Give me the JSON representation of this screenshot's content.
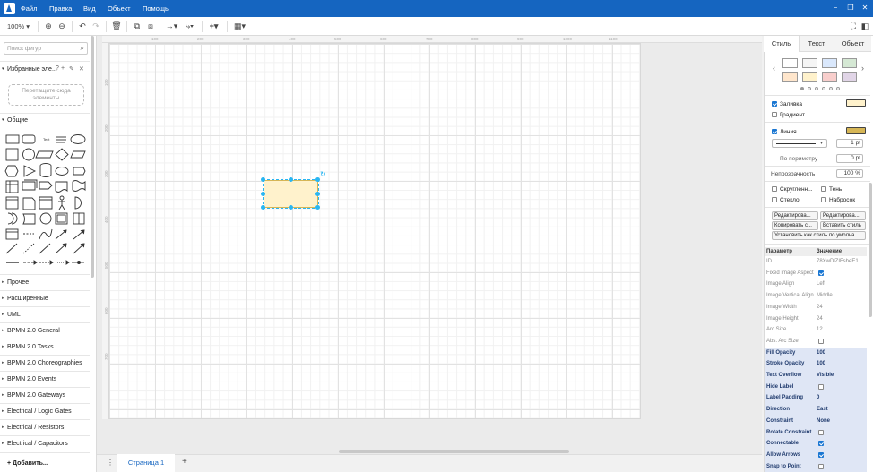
{
  "menubar": {
    "items": [
      "Файл",
      "Правка",
      "Вид",
      "Объект",
      "Помощь"
    ]
  },
  "toolbar": {
    "zoom": "100%"
  },
  "left": {
    "search_placeholder": "Поиск фигур",
    "favorites_label": "Избранные эле...",
    "dropzone_text": "Перетащите сюда элементы",
    "general_label": "Общие",
    "sections": [
      "Прочее",
      "Расширенные",
      "UML",
      "BPMN 2.0 General",
      "BPMN 2.0 Tasks",
      "BPMN 2.0 Choreographies",
      "BPMN 2.0 Events",
      "BPMN 2.0 Gateways",
      "Electrical / Logic Gates",
      "Electrical / Resistors",
      "Electrical / Capacitors"
    ],
    "add_more": "+ Добавить..."
  },
  "ruler": {
    "top": [
      "100",
      "200",
      "300",
      "400",
      "500",
      "600",
      "700",
      "800",
      "900",
      "1000",
      "1100"
    ],
    "left": [
      "100",
      "200",
      "300",
      "400",
      "500",
      "600",
      "700"
    ]
  },
  "pages": {
    "tab": "Страница 1"
  },
  "right": {
    "tabs": [
      "Стиль",
      "Текст",
      "Объект"
    ],
    "swatches": [
      "#ffffff",
      "#f5f5f5",
      "#dae8fc",
      "#d5e8d4",
      "#ffe6cc",
      "#fff2cc",
      "#f8cecc",
      "#e1d5e7"
    ],
    "fill": {
      "label": "Заливка",
      "checked": true,
      "color": "#fff2cc"
    },
    "gradient": {
      "label": "Градиент",
      "checked": false
    },
    "line": {
      "label": "Линия",
      "checked": true,
      "color": "#d6b656"
    },
    "line_width": "1 pt",
    "perimeter_label": "По периметру",
    "perimeter_value": "0 pt",
    "opacity_label": "Непрозрачность",
    "opacity_value": "100 %",
    "options": [
      {
        "label": "Скругленн...",
        "checked": false
      },
      {
        "label": "Тень",
        "checked": false
      },
      {
        "label": "Стекло",
        "checked": false
      },
      {
        "label": "Набросок",
        "checked": false
      }
    ],
    "buttons": [
      "Редактирова...",
      "Редактирова...",
      "Копировать с...",
      "Вставить стиль",
      "Установить как стиль по умолча..."
    ],
    "props_header": {
      "param": "Параметр",
      "value": "Значение"
    },
    "properties": [
      {
        "key": "ID",
        "value": "78XwDlZIFsheE1",
        "type": "text",
        "hl": false
      },
      {
        "key": "Fixed Image Aspect",
        "value": "",
        "type": "check",
        "checked": true,
        "hl": false
      },
      {
        "key": "Image Align",
        "value": "Left",
        "type": "text",
        "hl": false
      },
      {
        "key": "Image Vertical Align",
        "value": "Middle",
        "type": "text",
        "hl": false
      },
      {
        "key": "Image Width",
        "value": "24",
        "type": "text",
        "hl": false
      },
      {
        "key": "Image Height",
        "value": "24",
        "type": "text",
        "hl": false
      },
      {
        "key": "Arc Size",
        "value": "12",
        "type": "text",
        "hl": false
      },
      {
        "key": "Abs. Arc Size",
        "value": "",
        "type": "check",
        "checked": false,
        "hl": false
      },
      {
        "key": "Fill Opacity",
        "value": "100",
        "type": "text",
        "hl": true
      },
      {
        "key": "Stroke Opacity",
        "value": "100",
        "type": "text",
        "hl": true
      },
      {
        "key": "Text Overflow",
        "value": "Visible",
        "type": "text",
        "hl": true
      },
      {
        "key": "Hide Label",
        "value": "",
        "type": "check",
        "checked": false,
        "hl": true
      },
      {
        "key": "Label Padding",
        "value": "0",
        "type": "text",
        "hl": true
      },
      {
        "key": "Direction",
        "value": "East",
        "type": "text",
        "hl": true
      },
      {
        "key": "Constraint",
        "value": "None",
        "type": "text",
        "hl": true
      },
      {
        "key": "Rotate Constraint",
        "value": "",
        "type": "check",
        "checked": false,
        "hl": true
      },
      {
        "key": "Connectable",
        "value": "",
        "type": "check",
        "checked": true,
        "hl": true
      },
      {
        "key": "Allow Arrows",
        "value": "",
        "type": "check",
        "checked": true,
        "hl": true
      },
      {
        "key": "Snap to Point",
        "value": "",
        "type": "check",
        "checked": false,
        "hl": true
      }
    ]
  },
  "colors": {
    "accent": "#1565c0",
    "selection": "#29b6f2"
  }
}
